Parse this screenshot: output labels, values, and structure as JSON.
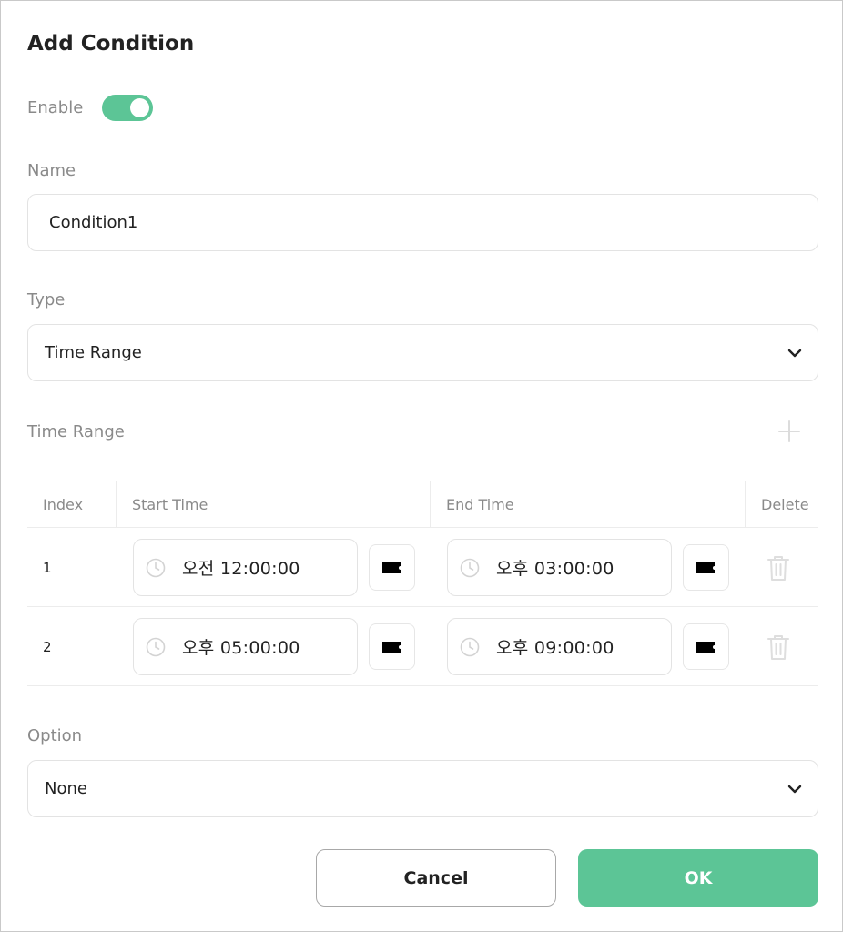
{
  "dialog": {
    "title": "Add Condition"
  },
  "enable": {
    "label": "Enable",
    "on": true,
    "color": "#5cc596"
  },
  "name": {
    "label": "Name",
    "value": "Condition1"
  },
  "type": {
    "label": "Type",
    "value": "Time Range"
  },
  "time_range": {
    "label": "Time Range",
    "add_icon": "plus-icon",
    "columns": [
      "Index",
      "Start Time",
      "End Time",
      "Delete"
    ],
    "rows": [
      {
        "index": "1",
        "start": "오전  12:00:00",
        "end": "오후  03:00:00"
      },
      {
        "index": "2",
        "start": "오후  05:00:00",
        "end": "오후  09:00:00"
      }
    ]
  },
  "option": {
    "label": "Option",
    "value": "None"
  },
  "buttons": {
    "cancel": "Cancel",
    "ok": "OK"
  }
}
